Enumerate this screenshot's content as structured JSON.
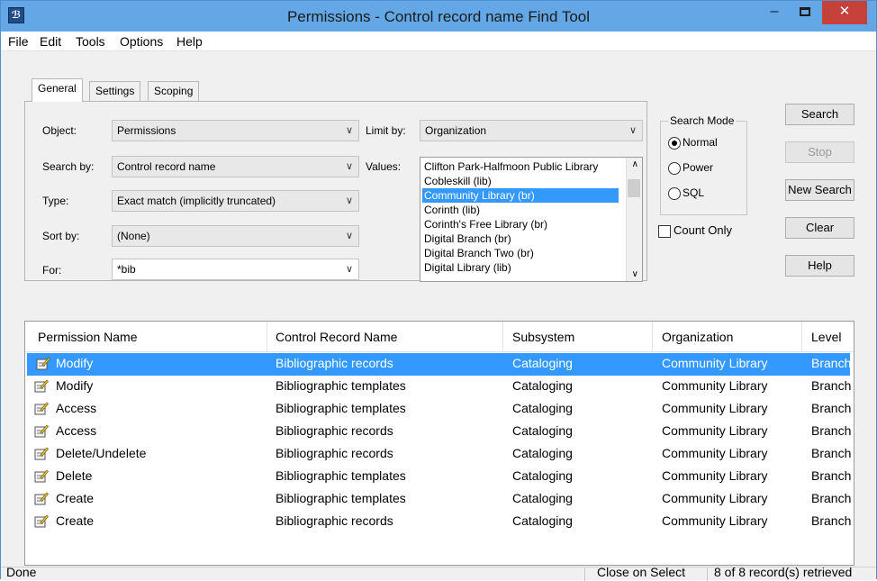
{
  "window": {
    "title": "Permissions - Control record name Find Tool",
    "minimize": "–",
    "close": "✕"
  },
  "menu": [
    "File",
    "Edit",
    "Tools",
    "Options",
    "Help"
  ],
  "tabs": [
    {
      "label": "General",
      "active": true
    },
    {
      "label": "Settings",
      "active": false
    },
    {
      "label": "Scoping",
      "active": false
    }
  ],
  "form": {
    "object": {
      "label": "Object:",
      "value": "Permissions"
    },
    "search_by": {
      "label": "Search by:",
      "value": "Control record name"
    },
    "type": {
      "label": "Type:",
      "value": "Exact match (implicitly truncated)"
    },
    "sort_by": {
      "label": "Sort by:",
      "value": "(None)"
    },
    "for": {
      "label": "For:",
      "value": "*bib"
    },
    "limit_by": {
      "label": "Limit by:",
      "value": "Organization"
    },
    "values_label": "Values:",
    "values": [
      "Clifton Park-Halfmoon Public Library",
      "Cobleskill (lib)",
      "Community Library  (br)",
      "Corinth (lib)",
      "Corinth's Free Library (br)",
      "Digital Branch (br)",
      "Digital Branch Two (br)",
      "Digital Library (lib)"
    ],
    "selected_value_index": 2
  },
  "search_mode": {
    "title": "Search Mode",
    "options": [
      "Normal",
      "Power",
      "SQL"
    ],
    "selected": "Normal"
  },
  "count_only": {
    "label": "Count Only",
    "checked": false
  },
  "buttons": {
    "search": "Search",
    "stop": "Stop",
    "new_search": "New Search",
    "clear": "Clear",
    "help": "Help"
  },
  "results": {
    "columns": [
      "Permission Name",
      "Control Record Name",
      "Subsystem",
      "Organization",
      "Level"
    ],
    "rows": [
      [
        "Modify",
        "Bibliographic records",
        "Cataloging",
        "Community Library",
        "Branch"
      ],
      [
        "Modify",
        "Bibliographic templates",
        "Cataloging",
        "Community Library",
        "Branch"
      ],
      [
        "Access",
        "Bibliographic templates",
        "Cataloging",
        "Community Library",
        "Branch"
      ],
      [
        "Access",
        "Bibliographic records",
        "Cataloging",
        "Community Library",
        "Branch"
      ],
      [
        "Delete/Undelete",
        "Bibliographic records",
        "Cataloging",
        "Community Library",
        "Branch"
      ],
      [
        "Delete",
        "Bibliographic templates",
        "Cataloging",
        "Community Library",
        "Branch"
      ],
      [
        "Create",
        "Bibliographic templates",
        "Cataloging",
        "Community Library",
        "Branch"
      ],
      [
        "Create",
        "Bibliographic records",
        "Cataloging",
        "Community Library",
        "Branch"
      ]
    ],
    "selected_row": 0,
    "row_icon": "permission-icon"
  },
  "status": {
    "left": "Done",
    "middle": "Close on Select",
    "right": "8 of 8 record(s) retrieved"
  },
  "colors": {
    "titlebar": "#63a7e6",
    "selection": "#3399ff",
    "close_button": "#c7413b"
  }
}
